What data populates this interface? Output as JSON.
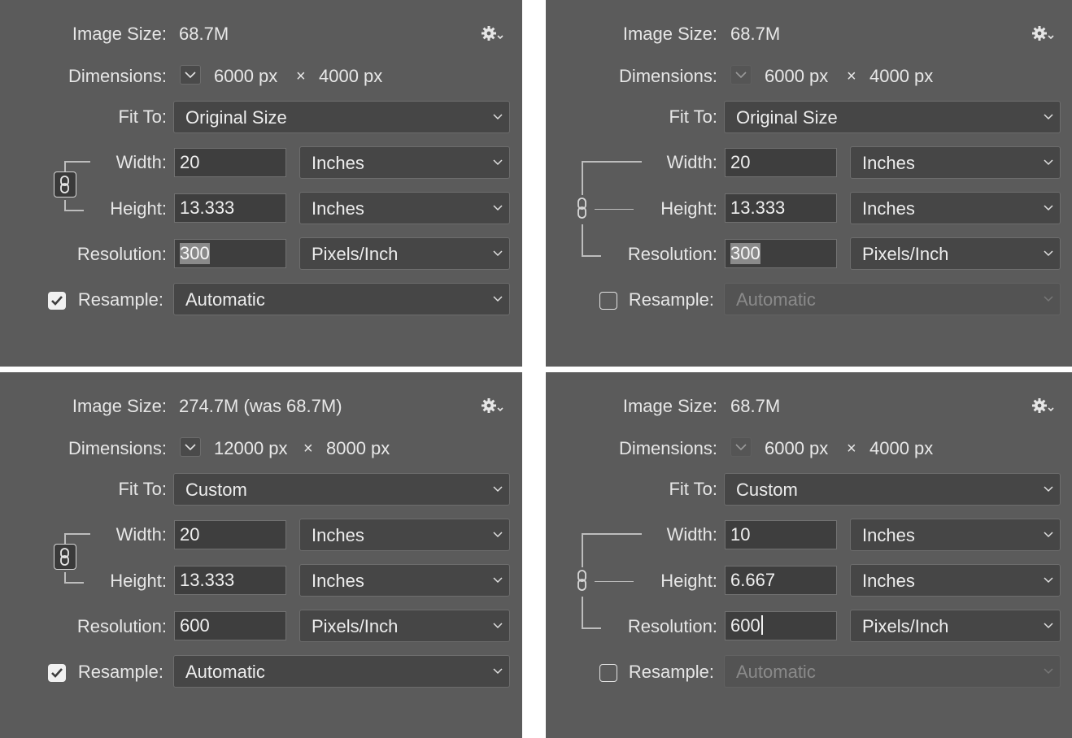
{
  "labels": {
    "image_size": "Image Size:",
    "dimensions": "Dimensions:",
    "fit_to": "Fit To:",
    "width": "Width:",
    "height": "Height:",
    "resolution": "Resolution:",
    "resample": "Resample:",
    "times": "×"
  },
  "icons": {
    "gear": "gear-icon",
    "dimensions_menu": "chevron-down-icon",
    "constrain": "chain-link-icon",
    "checkbox": "checkmark-icon"
  },
  "colors": {
    "panel_bg": "#5b5b5b",
    "field_bg": "#3e3e3e",
    "select_bg": "#464646",
    "text": "#e8e8e8",
    "disabled_text": "#8a8a8a"
  },
  "panels": [
    {
      "image_size": "68.7M",
      "dim_w": "6000 px",
      "dim_h": "4000 px",
      "fit_to": "Original Size",
      "width_value": "20",
      "width_unit": "Inches",
      "height_value": "13.333",
      "height_unit": "Inches",
      "resolution_value": "300",
      "resolution_unit": "Pixels/Inch",
      "resample_checked": true,
      "resample_value": "Automatic"
    },
    {
      "image_size": "68.7M",
      "dim_w": "6000 px",
      "dim_h": "4000 px",
      "fit_to": "Original Size",
      "width_value": "20",
      "width_unit": "Inches",
      "height_value": "13.333",
      "height_unit": "Inches",
      "resolution_value": "300",
      "resolution_unit": "Pixels/Inch",
      "resample_checked": false,
      "resample_value": "Automatic"
    },
    {
      "image_size": "274.7M (was 68.7M)",
      "dim_w": "12000 px",
      "dim_h": "8000 px",
      "fit_to": "Custom",
      "width_value": "20",
      "width_unit": "Inches",
      "height_value": "13.333",
      "height_unit": "Inches",
      "resolution_value": "600",
      "resolution_unit": "Pixels/Inch",
      "resample_checked": true,
      "resample_value": "Automatic"
    },
    {
      "image_size": "68.7M",
      "dim_w": "6000 px",
      "dim_h": "4000 px",
      "fit_to": "Custom",
      "width_value": "10",
      "width_unit": "Inches",
      "height_value": "6.667",
      "height_unit": "Inches",
      "resolution_value": "600",
      "resolution_unit": "Pixels/Inch",
      "resample_checked": false,
      "resample_value": "Automatic"
    }
  ]
}
